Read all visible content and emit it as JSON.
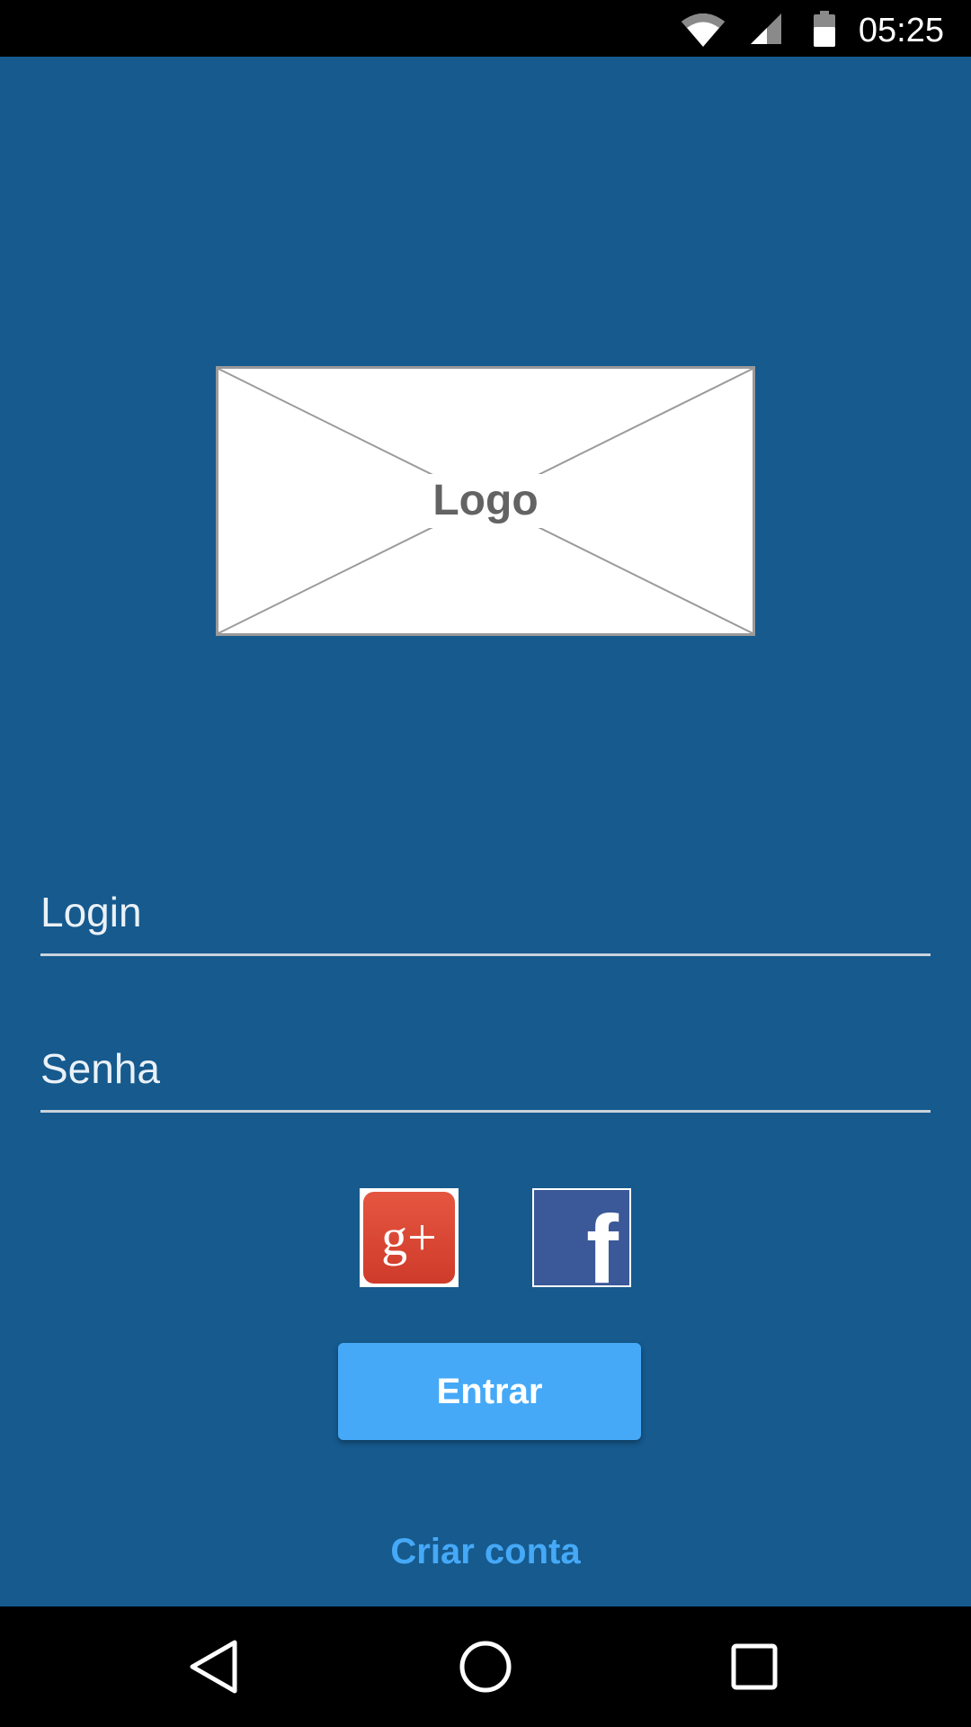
{
  "status_bar": {
    "time": "05:25",
    "icons": [
      "wifi-icon",
      "cellular-signal-icon",
      "battery-icon"
    ]
  },
  "logo": {
    "label": "Logo"
  },
  "form": {
    "login_placeholder": "Login",
    "password_placeholder": "Senha"
  },
  "social": {
    "google_label": "g+",
    "facebook_label": "f"
  },
  "actions": {
    "submit_label": "Entrar",
    "create_account_label": "Criar conta"
  },
  "nav_bar": {
    "icons": [
      "back-icon",
      "home-icon",
      "recents-icon"
    ]
  },
  "colors": {
    "background": "#165a8e",
    "accent": "#45a9f7",
    "google": "#dd4b39",
    "facebook": "#3b5998"
  }
}
